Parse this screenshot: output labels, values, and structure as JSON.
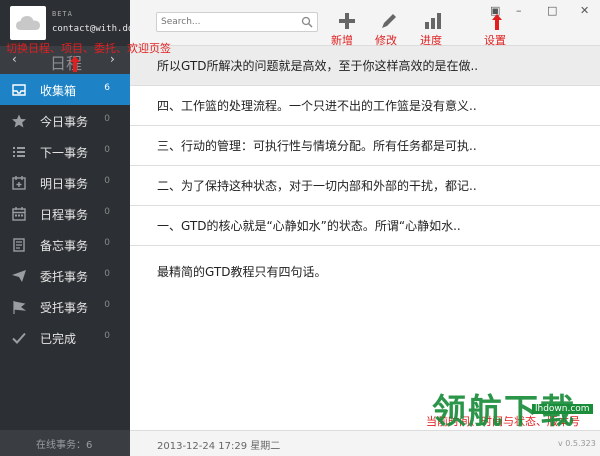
{
  "sidebar": {
    "beta_label": "BETA",
    "account": "contact@with.do",
    "annotation": "切换日程、项目、委托、欢迎页签",
    "nav_title": "日程",
    "items": [
      {
        "label": "收集箱",
        "count": "6",
        "icon": "inbox-icon"
      },
      {
        "label": "今日事务",
        "count": "0",
        "icon": "star-icon"
      },
      {
        "label": "下一事务",
        "count": "0",
        "icon": "list-icon"
      },
      {
        "label": "明日事务",
        "count": "0",
        "icon": "calendar-plus-icon"
      },
      {
        "label": "日程事务",
        "count": "0",
        "icon": "calendar-icon"
      },
      {
        "label": "备忘事务",
        "count": "0",
        "icon": "memo-icon"
      },
      {
        "label": "委托事务",
        "count": "0",
        "icon": "send-icon"
      },
      {
        "label": "受托事务",
        "count": "0",
        "icon": "flag-icon"
      },
      {
        "label": "已完成",
        "count": "0",
        "icon": "check-icon"
      }
    ],
    "footer": "在线事务：6"
  },
  "topbar": {
    "search_placeholder": "Search...",
    "new_label": "新增",
    "edit_label": "修改",
    "progress_label": "进度",
    "settings_label": "设置"
  },
  "list": {
    "rows": [
      "所以GTD所解决的问题就是高效，至于你这样高效的是在做..",
      "四、工作篮的处理流程。一个只进不出的工作篮是没有意义..",
      "三、行动的管理：可执行性与情境分配。所有任务都是可执..",
      "二、为了保持这种状态，对于一切内部和外部的干扰，都记..",
      "一、GTD的核心就是“心静如水”的状态。所谓“心静如水..",
      "最精简的GTD教程只有四句话。"
    ]
  },
  "bottombar": {
    "datetime": "2013-12-24 17:29 星期二",
    "status_note": "当前时间、时间与状态、版本号",
    "version": "v 0.5.323"
  },
  "watermark": {
    "text": "领航下载",
    "url": "lhdown.com"
  },
  "colors": {
    "sidebar_bg": "#2c2f33",
    "accent": "#1d83c6",
    "annotation_red": "#e02020",
    "watermark_green": "#1a8d3a"
  }
}
